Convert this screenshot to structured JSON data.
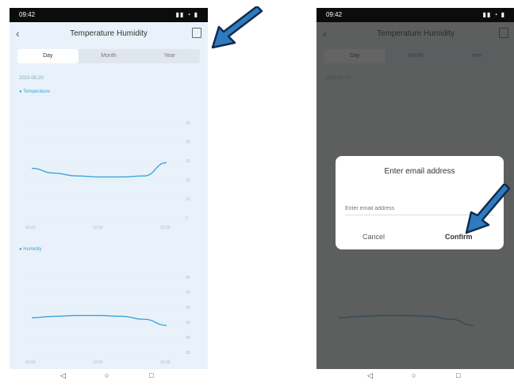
{
  "status_bar": {
    "time": "09:42",
    "icons": "▮▮ ◔ ▮"
  },
  "header": {
    "back": "‹",
    "title": "Temperature Humidity"
  },
  "tabs": [
    {
      "label": "Day",
      "active": true
    },
    {
      "label": "Month",
      "active": false
    },
    {
      "label": "Year",
      "active": false
    }
  ],
  "date_text": "2023-05-20",
  "temperature_label": "Temperature",
  "humidity_label": "Humidity",
  "temperature_chart": {
    "type": "line",
    "values": [
      52,
      47,
      44,
      43,
      43,
      44,
      58
    ],
    "y_ticks": [
      "30",
      "25",
      "20",
      "15",
      "10",
      "5"
    ],
    "x_ticks": [
      "00:00",
      "12:00",
      "23:59"
    ]
  },
  "humidity_chart": {
    "type": "line",
    "values": [
      46,
      48,
      49,
      49,
      48,
      44,
      36
    ],
    "y_ticks": [
      "80",
      "70",
      "60",
      "50",
      "40",
      "30"
    ],
    "x_ticks": [
      "00:00",
      "12:00",
      "23:59"
    ]
  },
  "dialog": {
    "title": "Enter email address",
    "placeholder": "Enter email address",
    "cancel": "Cancel",
    "confirm": "Confirm"
  },
  "nav": {
    "back": "◁",
    "home": "○",
    "recent": "□"
  },
  "colors": {
    "accent": "#3aa6d8",
    "arrow": "#2f7bbf",
    "arrow_outline": "#0f2c4d",
    "confirm": "#333333"
  }
}
